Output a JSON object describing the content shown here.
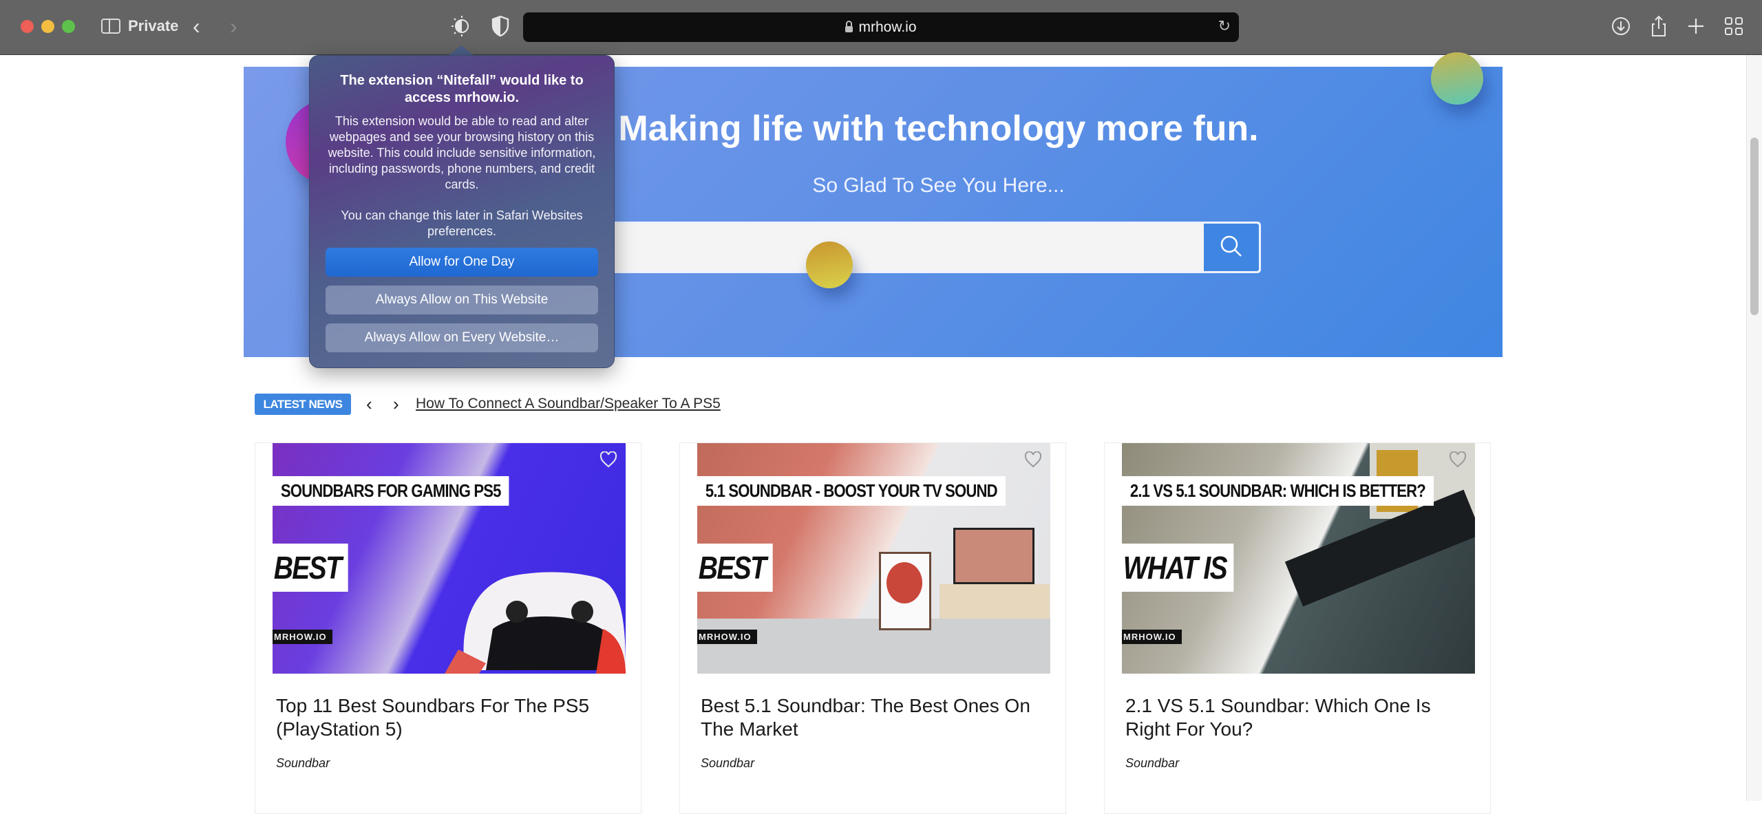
{
  "browser": {
    "mode_label": "Private",
    "url": "mrhow.io",
    "icons": {
      "sidebar": "sidebar-icon",
      "back": "chevron-left-icon",
      "forward": "chevron-right-icon",
      "extension_nitefall": "half-sun-icon",
      "extension_shield": "shield-icon",
      "lock": "lock-icon",
      "reload": "reload-icon",
      "download": "download-icon",
      "share": "share-icon",
      "new_tab": "plus-icon",
      "tab_overview": "grid-icon"
    },
    "back_glyph": "‹",
    "forward_glyph": "›",
    "reload_glyph": "↻"
  },
  "hero": {
    "title": "Making life with technology more fun.",
    "subtitle": "So Glad To See You Here...",
    "search_placeholder": "",
    "search_value": "",
    "colors": {
      "accent": "#3f86e2"
    }
  },
  "latest_news": {
    "badge": "LATEST NEWS",
    "prev_glyph": "‹",
    "next_glyph": "›",
    "headline": "How To Connect A Soundbar/Speaker To A PS5"
  },
  "cards": [
    {
      "title": "Top 11 Best Soundbars For The PS5 (PlayStation 5)",
      "category": "Soundbar",
      "thumb_heading": "SOUNDBARS FOR GAMING PS5",
      "thumb_tag": "BEST",
      "thumb_brand": "MRHOW.IO"
    },
    {
      "title": "Best 5.1 Soundbar: The Best Ones On The Market",
      "category": "Soundbar",
      "thumb_heading": "5.1 SOUNDBAR - BOOST YOUR TV SOUND",
      "thumb_tag": "BEST",
      "thumb_brand": "MRHOW.IO"
    },
    {
      "title": "2.1 VS 5.1 Soundbar: Which One Is Right For You?",
      "category": "Soundbar",
      "thumb_heading": "2.1 VS 5.1 SOUNDBAR: WHICH IS BETTER?",
      "thumb_tag": "WHAT IS",
      "thumb_brand": "MRHOW.IO"
    }
  ],
  "popup": {
    "title": "The extension “Nitefall” would like to access mrhow.io.",
    "body": "This extension would be able to read and alter webpages and see your browsing history on this website. This could include sensitive information, including passwords, phone numbers, and credit cards.",
    "note": "You can change this later in Safari Websites preferences.",
    "buttons": {
      "allow_one_day": "Allow for One Day",
      "always_this_site": "Always Allow on This Website",
      "always_every_site": "Always Allow on Every Website…"
    }
  }
}
